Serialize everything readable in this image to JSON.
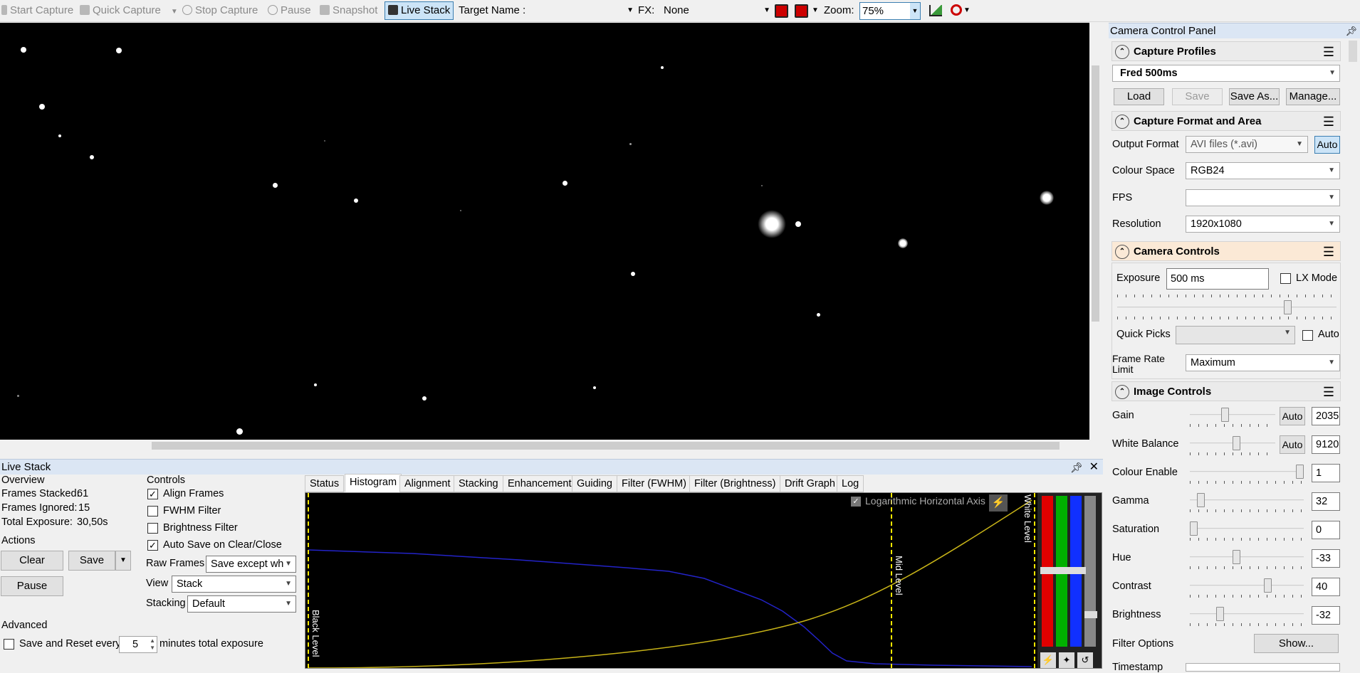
{
  "toolbar": {
    "start_capture": "Start Capture",
    "quick_capture": "Quick Capture",
    "stop_capture": "Stop Capture",
    "pause": "Pause",
    "snapshot": "Snapshot",
    "live_stack": "Live Stack",
    "target_name_label": "Target Name :",
    "fx_label": "FX:",
    "fx_value": "None",
    "zoom_label": "Zoom:",
    "zoom_value": "75%"
  },
  "live_stack": {
    "title": "Live Stack",
    "overview": {
      "heading": "Overview",
      "frames_stacked_label": "Frames Stacked:",
      "frames_stacked": "61",
      "frames_ignored_label": "Frames Ignored:",
      "frames_ignored": "15",
      "total_exposure_label": "Total Exposure:",
      "total_exposure": "30,50s"
    },
    "actions": {
      "heading": "Actions",
      "clear": "Clear",
      "save": "Save",
      "pause": "Pause"
    },
    "controls": {
      "heading": "Controls",
      "align_frames": "Align Frames",
      "align_frames_checked": true,
      "fwhm_filter": "FWHM Filter",
      "fwhm_checked": false,
      "brightness_filter": "Brightness Filter",
      "brightness_checked": false,
      "auto_save": "Auto Save on Clear/Close",
      "auto_save_checked": true,
      "raw_frames_label": "Raw Frames",
      "raw_frames_value": "Save except wh",
      "view_label": "View",
      "view_value": "Stack",
      "stacking_label": "Stacking",
      "stacking_value": "Default"
    },
    "advanced": {
      "heading": "Advanced",
      "save_reset_label": "Save and Reset every",
      "save_reset_value": "5",
      "minutes_label": "minutes total exposure"
    },
    "tabs": [
      "Status",
      "Histogram",
      "Alignment",
      "Stacking",
      "Enhancement",
      "Guiding",
      "Filter (FWHM)",
      "Filter (Brightness)",
      "Drift Graph",
      "Log"
    ],
    "active_tab": "Histogram",
    "histogram": {
      "log_axis_label": "Logarithmic Horizontal Axis",
      "black_level": "Black Level",
      "mid_level": "Mid Level",
      "white_level": "White Level"
    }
  },
  "camera_panel": {
    "title": "Camera Control Panel",
    "capture_profiles": {
      "heading": "Capture Profiles",
      "profile": "Fred 500ms",
      "load": "Load",
      "save": "Save",
      "save_as": "Save As...",
      "manage": "Manage..."
    },
    "capture_format": {
      "heading": "Capture Format and Area",
      "output_format_label": "Output Format",
      "output_format": "AVI files (*.avi)",
      "auto": "Auto",
      "colour_space_label": "Colour Space",
      "colour_space": "RGB24",
      "fps_label": "FPS",
      "fps": "",
      "resolution_label": "Resolution",
      "resolution": "1920x1080"
    },
    "camera_controls": {
      "heading": "Camera Controls",
      "exposure_label": "Exposure",
      "exposure": "500 ms",
      "lx_mode": "LX Mode",
      "quick_picks_label": "Quick Picks",
      "auto": "Auto",
      "frame_rate_label": "Frame Rate Limit",
      "frame_rate": "Maximum",
      "exposure_slider": 0.78
    },
    "image_controls": {
      "heading": "Image Controls",
      "auto": "Auto",
      "rows": [
        {
          "label": "Gain",
          "value": "2035",
          "auto": true,
          "pos": 0.4
        },
        {
          "label": "White Balance",
          "value": "9120",
          "auto": true,
          "pos": 0.55
        },
        {
          "label": "Colour Enable",
          "value": "1",
          "auto": false,
          "pos": 1.0
        },
        {
          "label": "Gamma",
          "value": "32",
          "auto": false,
          "pos": 0.07
        },
        {
          "label": "Saturation",
          "value": "0",
          "auto": false,
          "pos": 0.0
        },
        {
          "label": "Hue",
          "value": "-33",
          "auto": false,
          "pos": 0.4
        },
        {
          "label": "Contrast",
          "value": "40",
          "auto": false,
          "pos": 0.7
        },
        {
          "label": "Brightness",
          "value": "-32",
          "auto": false,
          "pos": 0.25
        }
      ],
      "filter_options_label": "Filter Options",
      "show": "Show...",
      "timestamp_label": "Timestamp"
    }
  }
}
